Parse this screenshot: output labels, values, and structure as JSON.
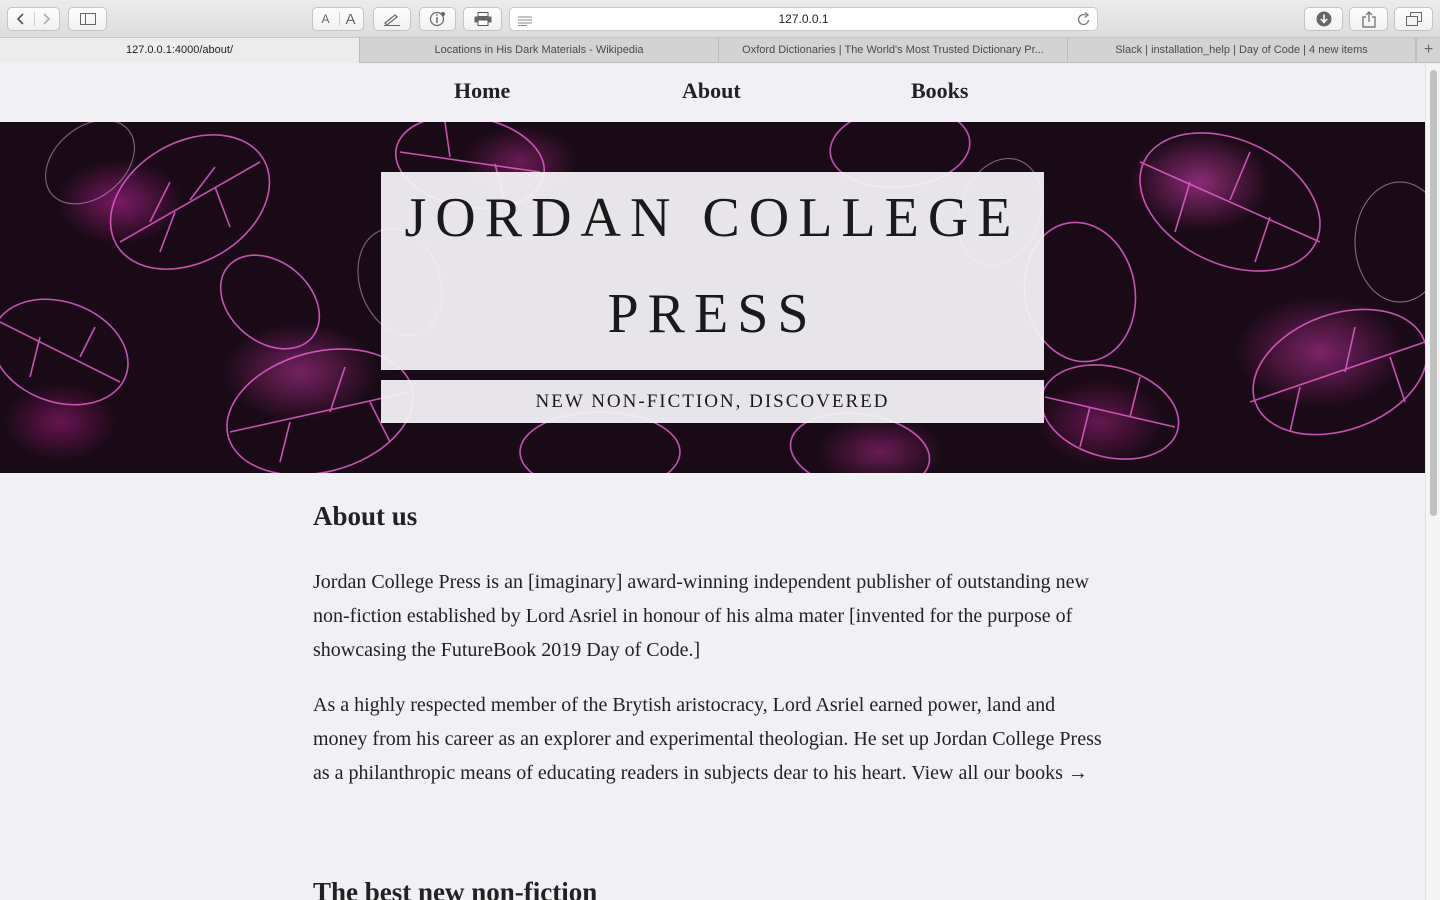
{
  "browser": {
    "url": "127.0.0.1",
    "text_small": "A",
    "text_large": "A",
    "tabs": [
      {
        "label": "127.0.0.1:4000/about/"
      },
      {
        "label": "Locations in His Dark Materials - Wikipedia"
      },
      {
        "label": "Oxford Dictionaries | The World's Most Trusted Dictionary Pr..."
      },
      {
        "label": "Slack | installation_help | Day of Code | 4 new items"
      }
    ],
    "new_tab": "+"
  },
  "nav": {
    "items": [
      "Home",
      "About",
      "Books"
    ]
  },
  "hero": {
    "title_line1": "JORDAN COLLEGE",
    "title_line2": "PRESS",
    "subtitle": "NEW NON-FICTION, DISCOVERED"
  },
  "about": {
    "heading": "About us",
    "para1": "Jordan College Press is an [imaginary] award-winning independent publisher of outstanding new non-fiction established by Lord Asriel in honour of his alma mater [invented for the purpose of showcasing the FutureBook 2019 Day of Code.]",
    "para2": "As a highly respected member of the Brytish aristocracy, Lord Asriel earned power, land and money from his career as an explorer and experimental theologian. He set up Jordan College Press as a philanthropic means of educating readers in subjects dear to his heart.",
    "link": "View all our books →"
  },
  "section2": {
    "heading": "The best new non-fiction"
  }
}
